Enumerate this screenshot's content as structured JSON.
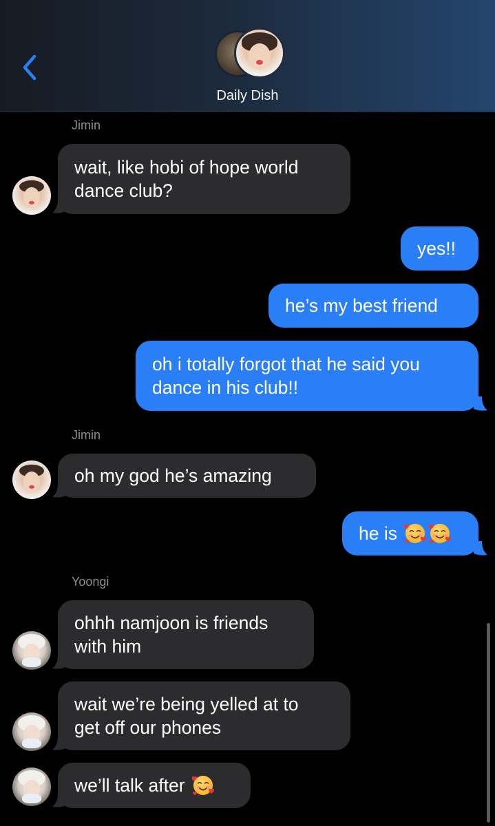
{
  "header": {
    "title": "Daily Dish",
    "back_icon": "chevron-left-icon",
    "accent": "#2a7ff6"
  },
  "messages": [
    {
      "sender": "Jimin",
      "text": "wait, like hobi of hope world\ndance club?"
    },
    {
      "text": "yes!!"
    },
    {
      "text": "he’s my best friend"
    },
    {
      "text": "oh i totally forgot that he said you\ndance in his club!!"
    },
    {
      "sender": "Jimin",
      "text": "oh my god he’s amazing"
    },
    {
      "text": "he is",
      "emoji": "smiling-face-with-hearts-icon"
    },
    {
      "sender": "Yoongi",
      "text": "ohhh namjoon is friends\nwith him"
    },
    {
      "text": "wait we’re being yelled at to\nget off our phones"
    },
    {
      "text": "we’ll talk after",
      "emoji": "smiling-face-with-hearts-icon"
    }
  ],
  "colors": {
    "incoming_bubble": "#2c2c2e",
    "outgoing_bubble": "#2a7ff6",
    "sender_label": "#8e8e93"
  }
}
